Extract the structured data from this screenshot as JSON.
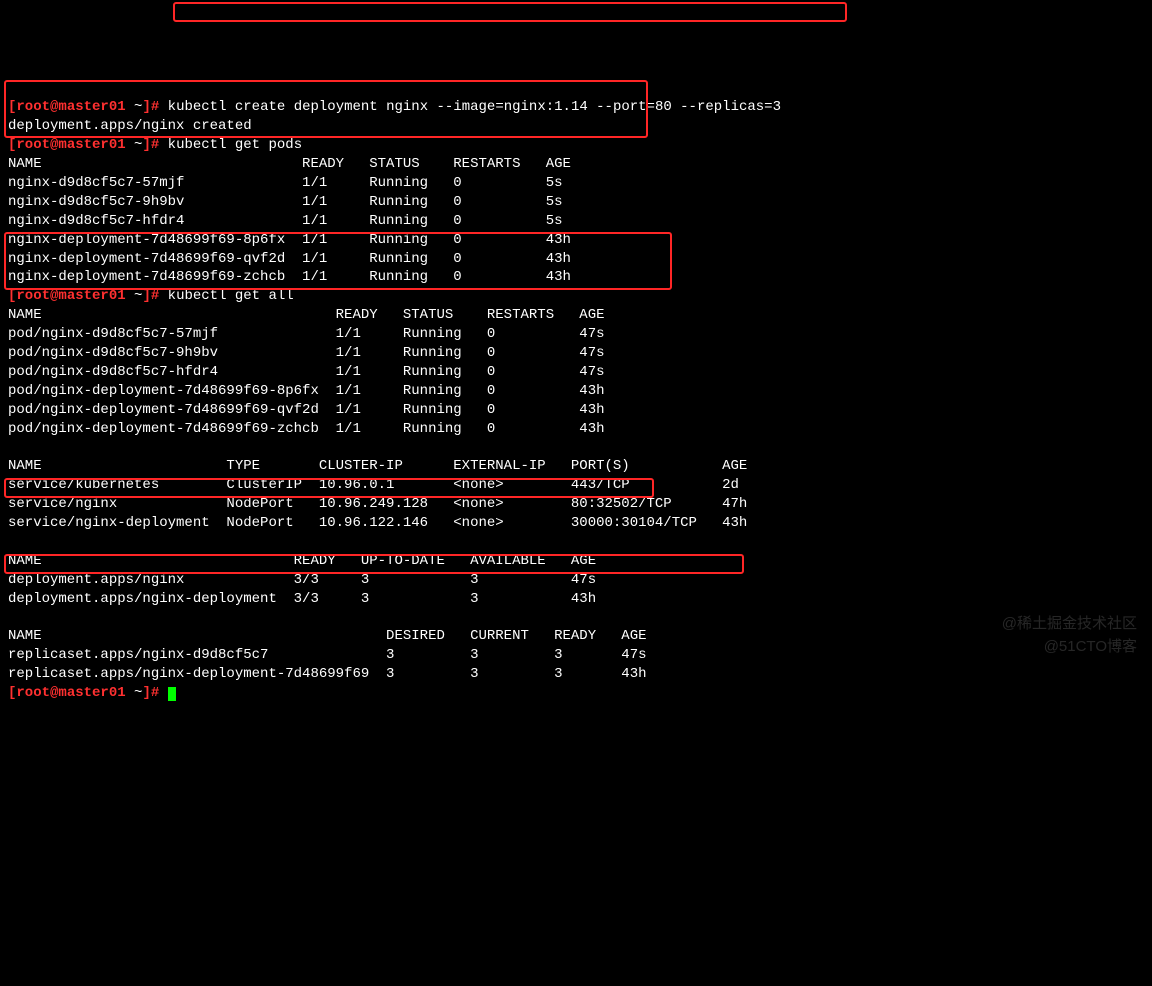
{
  "prompt": {
    "user": "root",
    "host": "master01",
    "path": "~",
    "open": "[",
    "at": "@",
    "close": "]#"
  },
  "cmd1": "kubectl create deployment nginx --image=nginx:1.14 --port=80 --replicas=3",
  "cmd1_out": "deployment.apps/nginx created",
  "cmd2": "kubectl get pods",
  "cmd3": "kubectl get all",
  "pods_header": "NAME                               READY   STATUS    RESTARTS   AGE",
  "pods": [
    "nginx-d9d8cf5c7-57mjf              1/1     Running   0          5s",
    "nginx-d9d8cf5c7-9h9bv              1/1     Running   0          5s",
    "nginx-d9d8cf5c7-hfdr4              1/1     Running   0          5s",
    "nginx-deployment-7d48699f69-8p6fx  1/1     Running   0          43h",
    "nginx-deployment-7d48699f69-qvf2d  1/1     Running   0          43h",
    "nginx-deployment-7d48699f69-zchcb  1/1     Running   0          43h"
  ],
  "all_pods_header": "NAME                                   READY   STATUS    RESTARTS   AGE",
  "all_pods": [
    "pod/nginx-d9d8cf5c7-57mjf              1/1     Running   0          47s",
    "pod/nginx-d9d8cf5c7-9h9bv              1/1     Running   0          47s",
    "pod/nginx-d9d8cf5c7-hfdr4              1/1     Running   0          47s",
    "pod/nginx-deployment-7d48699f69-8p6fx  1/1     Running   0          43h",
    "pod/nginx-deployment-7d48699f69-qvf2d  1/1     Running   0          43h",
    "pod/nginx-deployment-7d48699f69-zchcb  1/1     Running   0          43h"
  ],
  "svc_header": "NAME                      TYPE       CLUSTER-IP      EXTERNAL-IP   PORT(S)           AGE",
  "svc": [
    "service/kubernetes        ClusterIP  10.96.0.1       <none>        443/TCP           2d",
    "service/nginx             NodePort   10.96.249.128   <none>        80:32502/TCP      47h",
    "service/nginx-deployment  NodePort   10.96.122.146   <none>        30000:30104/TCP   43h"
  ],
  "deploy_header": "NAME                              READY   UP-TO-DATE   AVAILABLE   AGE",
  "deploy": [
    "deployment.apps/nginx             3/3     3            3           47s",
    "deployment.apps/nginx-deployment  3/3     3            3           43h"
  ],
  "rs_header": "NAME                                         DESIRED   CURRENT   READY   AGE",
  "rs": [
    "replicaset.apps/nginx-d9d8cf5c7              3         3         3       47s",
    "replicaset.apps/nginx-deployment-7d48699f69  3         3         3       43h"
  ],
  "watermarks": {
    "w1": "@稀土掘金技术社区",
    "w2": "@51CTO博客"
  }
}
